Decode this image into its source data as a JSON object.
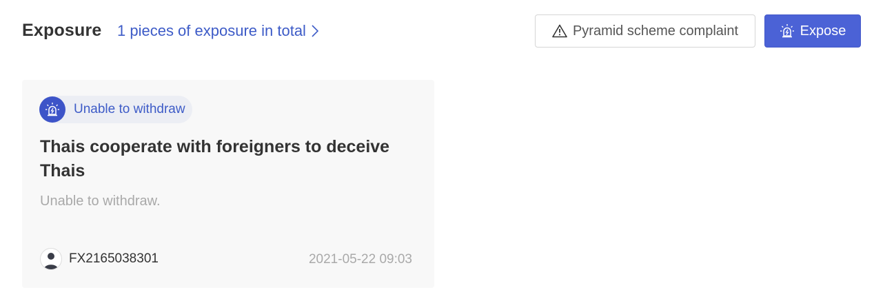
{
  "header": {
    "title": "Exposure",
    "count_link": "1 pieces of exposure in total",
    "complaint_button": "Pyramid scheme complaint",
    "expose_button": "Expose"
  },
  "card": {
    "tag": "Unable to withdraw",
    "title": "Thais cooperate with foreigners to deceive Thais",
    "description": "Unable to withdraw.",
    "author": "FX2165038301",
    "date": "2021-05-22 09:03"
  },
  "colors": {
    "accent": "#4b62d6",
    "link": "#3d5bc7",
    "muted": "#a9a9a9"
  },
  "icons": [
    "chevron-right-icon",
    "warning-triangle-icon",
    "alarm-siren-icon",
    "user-avatar-icon"
  ]
}
